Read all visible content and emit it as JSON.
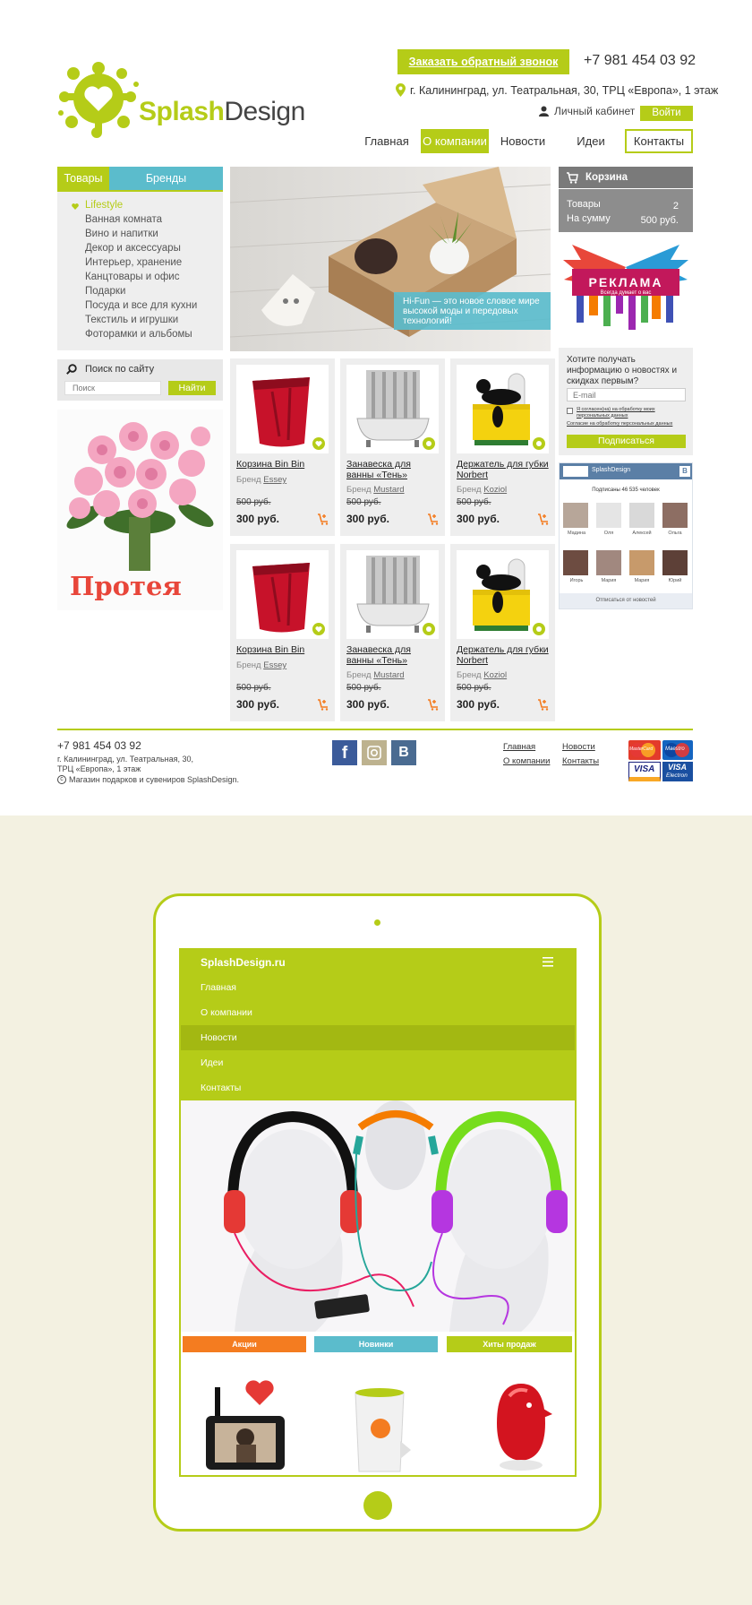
{
  "header": {
    "logo_brand_green": "Splash",
    "logo_brand_dark": "Design",
    "callback_button": "Заказать обратный звонок",
    "phone": "+7 981 454 03 92",
    "address": "г. Калининград, ул. Театральная, 30, ТРЦ «Европа», 1 этаж",
    "cabinet_label": "Личный кабинет",
    "login_button": "Войти",
    "nav": [
      "Главная",
      "О компании",
      "Новости",
      "Идеи",
      "Контакты"
    ]
  },
  "sidebar": {
    "tab_goods": "Товары",
    "tab_brands": "Бренды",
    "categories": [
      "Lifestyle",
      "Ванная комната",
      "Вино и напитки",
      "Декор и аксессуары",
      "Интерьер, хранение",
      "Канцтовары и офис",
      "Подарки",
      "Посуда и все для кухни",
      "Текстиль и игрушки",
      "Фоторамки и альбомы"
    ],
    "search_title": "Поиск по сайту",
    "search_placeholder": "Поиск",
    "search_button": "Найти",
    "banner_text": "Протея"
  },
  "hero": {
    "caption_accent": "Hi-Fun",
    "caption_text": " — это новое словое мире высокой моды и передовых технологий!"
  },
  "products": [
    {
      "name": "Корзина Bin Bin",
      "brand_label": "Бренд",
      "brand": "Essey",
      "old_price": "500 руб.",
      "price": "300 руб."
    },
    {
      "name": "Занавеска для ванны «Тень»",
      "brand_label": "Бренд",
      "brand": "Mustard",
      "old_price": "500 руб.",
      "price": "300 руб."
    },
    {
      "name": "Держатель для губки Norbert",
      "brand_label": "Бренд",
      "brand": "Koziol",
      "old_price": "500 руб.",
      "price": "300 руб."
    },
    {
      "name": "Корзина Bin Bin",
      "brand_label": "Бренд",
      "brand": "Essey",
      "old_price": "500 руб.",
      "price": "300 руб."
    },
    {
      "name": "Занавеска для ванны «Тень»",
      "brand_label": "Бренд",
      "brand": "Mustard",
      "old_price": "500 руб.",
      "price": "300 руб."
    },
    {
      "name": "Держатель для губки Norbert",
      "brand_label": "Бренд",
      "brand": "Koziol",
      "old_price": "500 руб.",
      "price": "300 руб."
    }
  ],
  "basket": {
    "title": "Корзина",
    "items_label": "Товары",
    "items_value": "2",
    "sum_label": "На сумму",
    "sum_value": "500 руб."
  },
  "ad": {
    "title": "РЕКЛАМА",
    "subtitle": "Всегда думает о вас"
  },
  "subscribe": {
    "question": "Хотите получать информацию о новостях и скидках первым?",
    "email_placeholder": "E-mail",
    "consent": "Я согласен(на) на обработку моих персональных данных",
    "consent_link": "Согласие на обработку персональных данных",
    "button": "Подписаться"
  },
  "vk": {
    "group": "SplashDesign",
    "badge": "В",
    "subscribers": "Подписаны 46 535 человек",
    "members": [
      "Мадина",
      "Оля",
      "Алексей",
      "Ольга",
      "Игорь",
      "Мария",
      "Мария",
      "Юрий"
    ],
    "unsubscribe": "Отписаться от новостей"
  },
  "footer": {
    "phone": "+7 981 454 03 92",
    "address_line1": "г. Калининград, ул. Театральная, 30,",
    "address_line2": "ТРЦ «Европа», 1 этаж",
    "copyright_sign": "c",
    "copyright": "Магазин подарков и сувениров SplashDesign.",
    "links_col1": [
      "Главная",
      "О компании"
    ],
    "links_col2": [
      "Новости",
      "Контакты"
    ],
    "social": {
      "facebook": "f",
      "vk": "В"
    },
    "payment": {
      "mastercard": "MasterCard",
      "maestro": "Maestro",
      "visa": "VISA",
      "visa_electron": "VISA",
      "electron": "Electron"
    }
  },
  "tablet": {
    "site_title": "SplashDesign.ru",
    "menu": [
      "Главная",
      "О компании",
      "Новости",
      "Идеи",
      "Контакты"
    ],
    "tabs": [
      "Акции",
      "Новинки",
      "Хиты продаж"
    ]
  },
  "colors": {
    "green": "#b5cc18",
    "blue": "#5bbccc",
    "orange": "#f47c20",
    "grey": "#7a7a7a"
  }
}
